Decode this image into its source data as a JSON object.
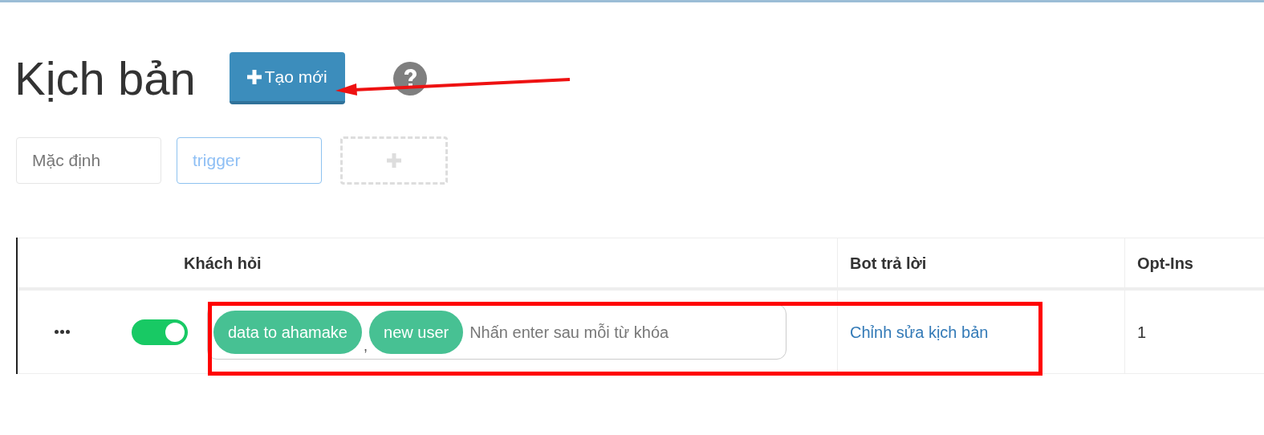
{
  "page": {
    "title": "Kịch bản",
    "create_button": {
      "label": "Tạo mới"
    }
  },
  "tabs": [
    {
      "label": "Mặc định",
      "selected": false
    },
    {
      "label": "trigger",
      "selected": true
    }
  ],
  "table": {
    "columns": [
      "Khách hỏi",
      "Bot trả lời",
      "Opt-Ins"
    ],
    "rows": [
      {
        "on": true,
        "keywords": [
          "data to ahamake",
          "new user"
        ],
        "separator": ",",
        "placeholder": "Nhấn enter sau mỗi từ khóa",
        "reply_link": "Chỉnh sửa kịch bản",
        "opt_ins": "1"
      }
    ]
  }
}
